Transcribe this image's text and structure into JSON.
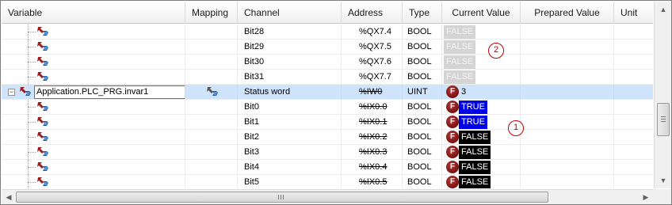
{
  "columns": {
    "variable": "Variable",
    "mapping": "Mapping",
    "channel": "Channel",
    "address": "Address",
    "type": "Type",
    "current_value": "Current Value",
    "prepared_value": "Prepared Value",
    "unit": "Unit"
  },
  "rows": [
    {
      "kind": "bit",
      "channel": "Bit28",
      "address": "%QX7.4",
      "type": "BOOL",
      "forced": false,
      "value": "FALSE",
      "value_style": "greyed",
      "struck": false
    },
    {
      "kind": "bit",
      "channel": "Bit29",
      "address": "%QX7.5",
      "type": "BOOL",
      "forced": false,
      "value": "FALSE",
      "value_style": "greyed",
      "struck": false
    },
    {
      "kind": "bit",
      "channel": "Bit30",
      "address": "%QX7.6",
      "type": "BOOL",
      "forced": false,
      "value": "FALSE",
      "value_style": "greyed",
      "struck": false
    },
    {
      "kind": "bit",
      "channel": "Bit31",
      "address": "%QX7.7",
      "type": "BOOL",
      "forced": false,
      "value": "FALSE",
      "value_style": "greyed",
      "struck": false
    },
    {
      "kind": "parent",
      "variable": "Application.PLC_PRG.invar1",
      "channel": "Status word",
      "address": "%IW0",
      "type": "UINT",
      "forced": true,
      "force_label": "F",
      "value": "3",
      "value_style": "plain",
      "struck": true,
      "expander": "−"
    },
    {
      "kind": "bit",
      "channel": "Bit0",
      "address": "%IX0.0",
      "type": "BOOL",
      "forced": true,
      "force_label": "F",
      "value": "TRUE",
      "value_style": "true",
      "struck": true
    },
    {
      "kind": "bit",
      "channel": "Bit1",
      "address": "%IX0.1",
      "type": "BOOL",
      "forced": true,
      "force_label": "F",
      "value": "TRUE",
      "value_style": "true",
      "struck": true
    },
    {
      "kind": "bit",
      "channel": "Bit2",
      "address": "%IX0.2",
      "type": "BOOL",
      "forced": true,
      "force_label": "F",
      "value": "FALSE",
      "value_style": "false",
      "struck": true
    },
    {
      "kind": "bit",
      "channel": "Bit3",
      "address": "%IX0.3",
      "type": "BOOL",
      "forced": true,
      "force_label": "F",
      "value": "FALSE",
      "value_style": "false",
      "struck": true
    },
    {
      "kind": "bit",
      "channel": "Bit4",
      "address": "%IX0.4",
      "type": "BOOL",
      "forced": true,
      "force_label": "F",
      "value": "FALSE",
      "value_style": "false",
      "struck": true
    },
    {
      "kind": "bit",
      "channel": "Bit5",
      "address": "%IX0.5",
      "type": "BOOL",
      "forced": true,
      "force_label": "F",
      "value": "FALSE",
      "value_style": "false",
      "struck": true
    }
  ],
  "callouts": [
    {
      "label": "2"
    },
    {
      "label": "1"
    }
  ],
  "scrollbars": {
    "up_arrow": "▲",
    "down_arrow": "▼",
    "left_arrow": "◀",
    "right_arrow": "▶"
  },
  "colors": {
    "selected_row": "#cfe4fa",
    "true_value_bg": "#0000e6",
    "false_value_bg": "#000000",
    "greyed_value_bg": "#d4d4d4",
    "force_badge": "#8b1a1a",
    "callout": "#c00000"
  },
  "icons": {
    "variable": "io-variable-icon",
    "mapping": "mapping-variable-icon",
    "force": "force-badge-icon"
  }
}
